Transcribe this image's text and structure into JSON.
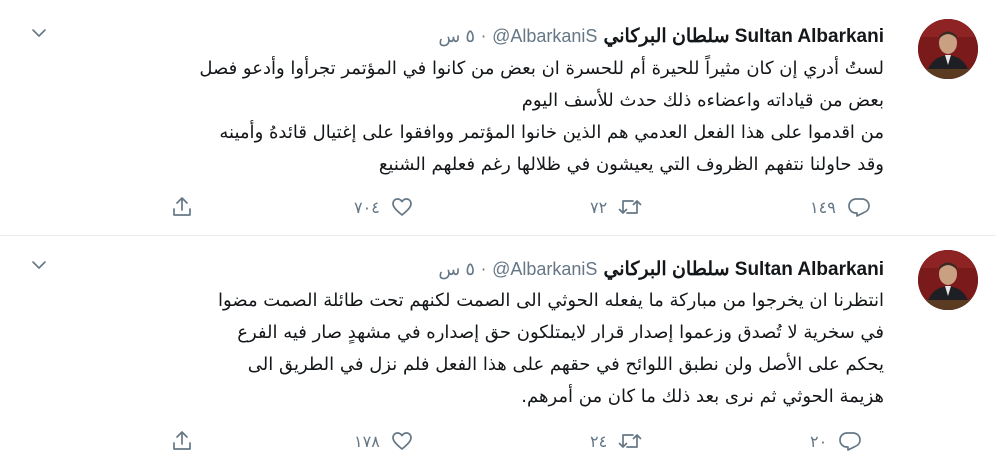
{
  "colors": {
    "text": "#14171a",
    "secondary": "#657786",
    "divider": "#e6ecf0",
    "icon": "#657786"
  },
  "tweets": [
    {
      "name": "Sultan Albarkani سلطان البركاني",
      "handle": "@AlbarkaniS",
      "time": "٥ س",
      "lines": [
        "لستُ أدري إن كان مثيراً للحيرة أم للحسرة ان بعض من كانوا في المؤتمر تجرأوا وأدعو فصل",
        "بعض من قياداته واعضاءه ذلك حدث للأسف اليوم",
        "من اقدموا على هذا الفعل العدمي هم الذين خانوا المؤتمر ووافقوا على إغتيال قائدهُ وأمينه",
        "وقد حاولنا نتفهم الظروف التي يعيشون في ظلالها رغم فعلهم الشنيع"
      ],
      "replies": "١٤٩",
      "retweets": "٧٢",
      "likes": "٧٠٤",
      "icons": {
        "more": "chevron-down-icon",
        "reply": "reply-icon",
        "retweet": "retweet-icon",
        "like": "heart-icon",
        "share": "share-icon"
      }
    },
    {
      "name": "Sultan Albarkani سلطان البركاني",
      "handle": "@AlbarkaniS",
      "time": "٥ س",
      "lines": [
        "انتظرنا ان يخرجوا من مباركة ما يفعله الحوثي الى الصمت لكنهم تحت طائلة الصمت مضوا",
        "في سخرية لا تُصدق وزعموا إصدار قرار لايمتلكون حق إصداره في مشهدٍ صار فيه الفرع",
        "يحكم على الأصل ولن نطبق اللوائح في حقهم على هذا الفعل فلم نزل في الطريق الى",
        "هزيمة الحوثي ثم نرى بعد ذلك ما كان من أمرهم."
      ],
      "replies": "٢٠",
      "retweets": "٢٤",
      "likes": "١٧٨",
      "icons": {
        "more": "chevron-down-icon",
        "reply": "reply-icon",
        "retweet": "retweet-icon",
        "like": "heart-icon",
        "share": "share-icon"
      }
    }
  ]
}
